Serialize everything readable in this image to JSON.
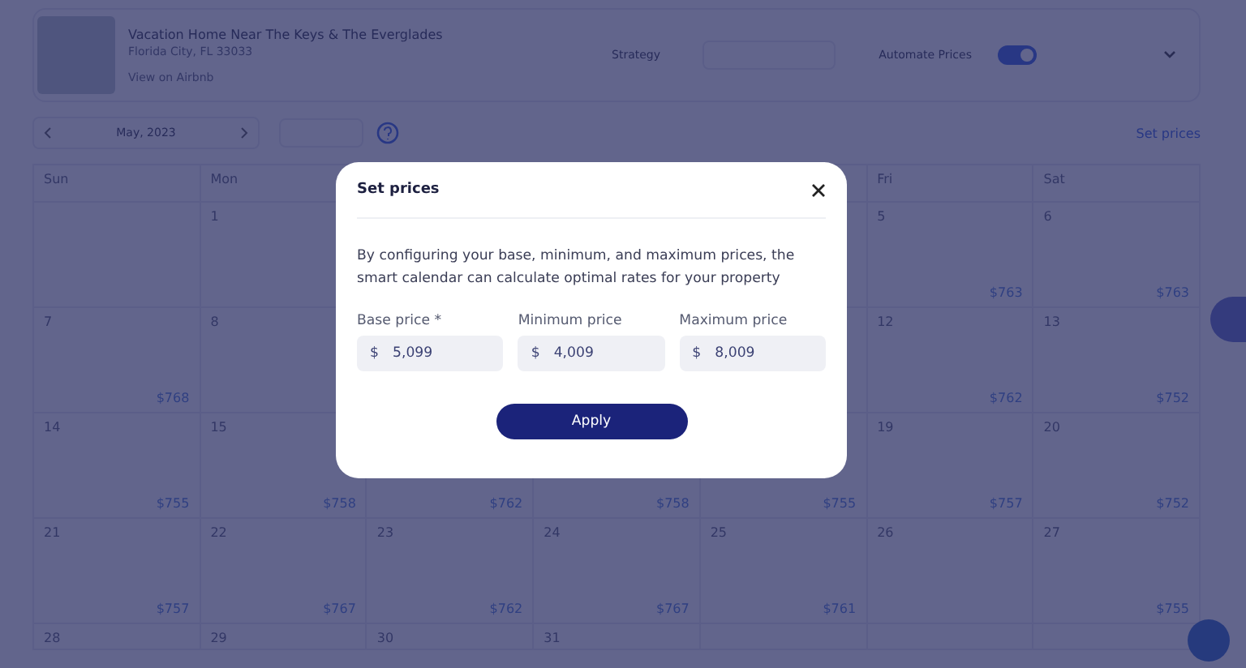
{
  "listing": {
    "title": "Vacation Home Near The Keys & The Everglades",
    "location": "Florida City, FL 33033",
    "link": "View on Airbnb",
    "strategy_label": "Strategy",
    "automate": {
      "label": "Automate Prices",
      "on": true
    }
  },
  "toolbar": {
    "month": "May, 2023",
    "set_prices": "Set prices"
  },
  "calendar": {
    "weekdays": [
      {
        "kind": "label",
        "text": "Sun"
      },
      {
        "kind": "label",
        "text": "Mon"
      },
      {
        "kind": "blank"
      },
      {
        "kind": "blank"
      },
      {
        "kind": "blank"
      },
      {
        "kind": "label",
        "text": "Fri"
      },
      {
        "kind": "label",
        "text": "Sat"
      }
    ],
    "weeks": [
      [
        {
          "kind": "blank"
        },
        {
          "kind": "day",
          "day": "1"
        },
        {
          "kind": "blank"
        },
        {
          "kind": "blank"
        },
        {
          "kind": "blank"
        },
        {
          "kind": "day",
          "day": "5",
          "price": "$763"
        },
        {
          "kind": "day",
          "day": "6",
          "price": "$763"
        }
      ],
      [
        {
          "kind": "day",
          "day": "7",
          "price": "$768"
        },
        {
          "kind": "day",
          "day": "8"
        },
        {
          "kind": "blank"
        },
        {
          "kind": "blank"
        },
        {
          "kind": "blank"
        },
        {
          "kind": "day",
          "day": "12",
          "price": "$762"
        },
        {
          "kind": "day",
          "day": "13",
          "price": "$752"
        }
      ],
      [
        {
          "kind": "day",
          "day": "14",
          "price": "$755"
        },
        {
          "kind": "day",
          "day": "15",
          "price": "$758"
        },
        {
          "kind": "day",
          "price": "$762"
        },
        {
          "kind": "day",
          "price": "$758"
        },
        {
          "kind": "day",
          "price": "$755"
        },
        {
          "kind": "day",
          "day": "19",
          "price": "$757"
        },
        {
          "kind": "day",
          "day": "20",
          "price": "$752"
        }
      ],
      [
        {
          "kind": "day",
          "day": "21",
          "price": "$757"
        },
        {
          "kind": "day",
          "day": "22",
          "price": "$767"
        },
        {
          "kind": "day",
          "day": "23",
          "price": "$762"
        },
        {
          "kind": "day",
          "day": "24",
          "price": "$767"
        },
        {
          "kind": "day",
          "day": "25",
          "price": "$761"
        },
        {
          "kind": "day",
          "day": "26"
        },
        {
          "kind": "day",
          "day": "27",
          "price": "$755"
        }
      ],
      [
        {
          "kind": "day",
          "day": "28"
        },
        {
          "kind": "day",
          "day": "29"
        },
        {
          "kind": "day",
          "day": "30"
        },
        {
          "kind": "day",
          "day": "31"
        },
        {
          "kind": "blank"
        },
        {
          "kind": "blank"
        },
        {
          "kind": "blank"
        }
      ]
    ]
  },
  "dialog": {
    "title": "Set prices",
    "text": "By configuring your base, minimum, and maximum prices, the smart calendar can calculate optimal rates for your property",
    "fields": [
      {
        "label": "Base price *",
        "currency": "$",
        "value": "5,099"
      },
      {
        "label": "Minimum price",
        "currency": "$",
        "value": "4,009"
      },
      {
        "label": "Maximum price",
        "currency": "$",
        "value": "8,009"
      }
    ],
    "button": "Apply"
  }
}
